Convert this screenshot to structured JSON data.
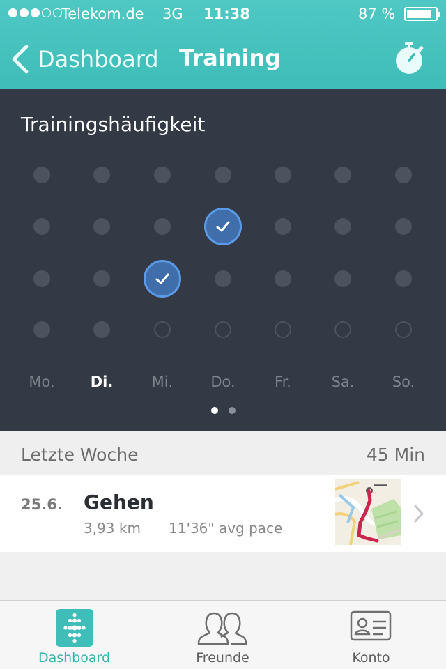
{
  "status_bar": {
    "carrier": "Telekom.de",
    "network": "3G",
    "time": "11:38",
    "battery_percent": "87 %",
    "battery_level": 0.87,
    "signal_bars": 3,
    "signal_total": 5
  },
  "nav": {
    "back_label": "Dashboard",
    "title": "Training",
    "back_icon": "chevron-left-icon",
    "action_icon": "stopwatch-icon"
  },
  "frequency": {
    "title": "Trainingshäufigkeit",
    "days": [
      "Mo.",
      "Di.",
      "Mi.",
      "Do.",
      "Fr.",
      "Sa.",
      "So."
    ],
    "today_index": 1,
    "grid": [
      [
        "filled",
        "filled",
        "filled",
        "filled",
        "filled",
        "filled",
        "filled"
      ],
      [
        "filled",
        "filled",
        "filled",
        "done",
        "filled",
        "filled",
        "filled"
      ],
      [
        "filled",
        "filled",
        "done",
        "filled",
        "filled",
        "filled",
        "filled"
      ],
      [
        "filled",
        "filled",
        "empty",
        "empty",
        "empty",
        "empty",
        "empty"
      ]
    ],
    "pages": 2,
    "active_page": 0
  },
  "week": {
    "label": "Letzte Woche",
    "total": "45 Min"
  },
  "activities": [
    {
      "date": "25.6.",
      "name": "Gehen",
      "distance": "3,93 km",
      "pace": "11'36\" avg pace"
    }
  ],
  "tabs": [
    {
      "label": "Dashboard",
      "icon": "fitbit-icon",
      "active": true
    },
    {
      "label": "Freunde",
      "icon": "friends-icon",
      "active": false
    },
    {
      "label": "Konto",
      "icon": "account-card-icon",
      "active": false
    }
  ],
  "colors": {
    "brand": "#3fbdb8",
    "panel": "#343a45",
    "check_fill": "#3f6eaa",
    "check_ring": "#5a9ae6",
    "route": "#c8264c"
  }
}
